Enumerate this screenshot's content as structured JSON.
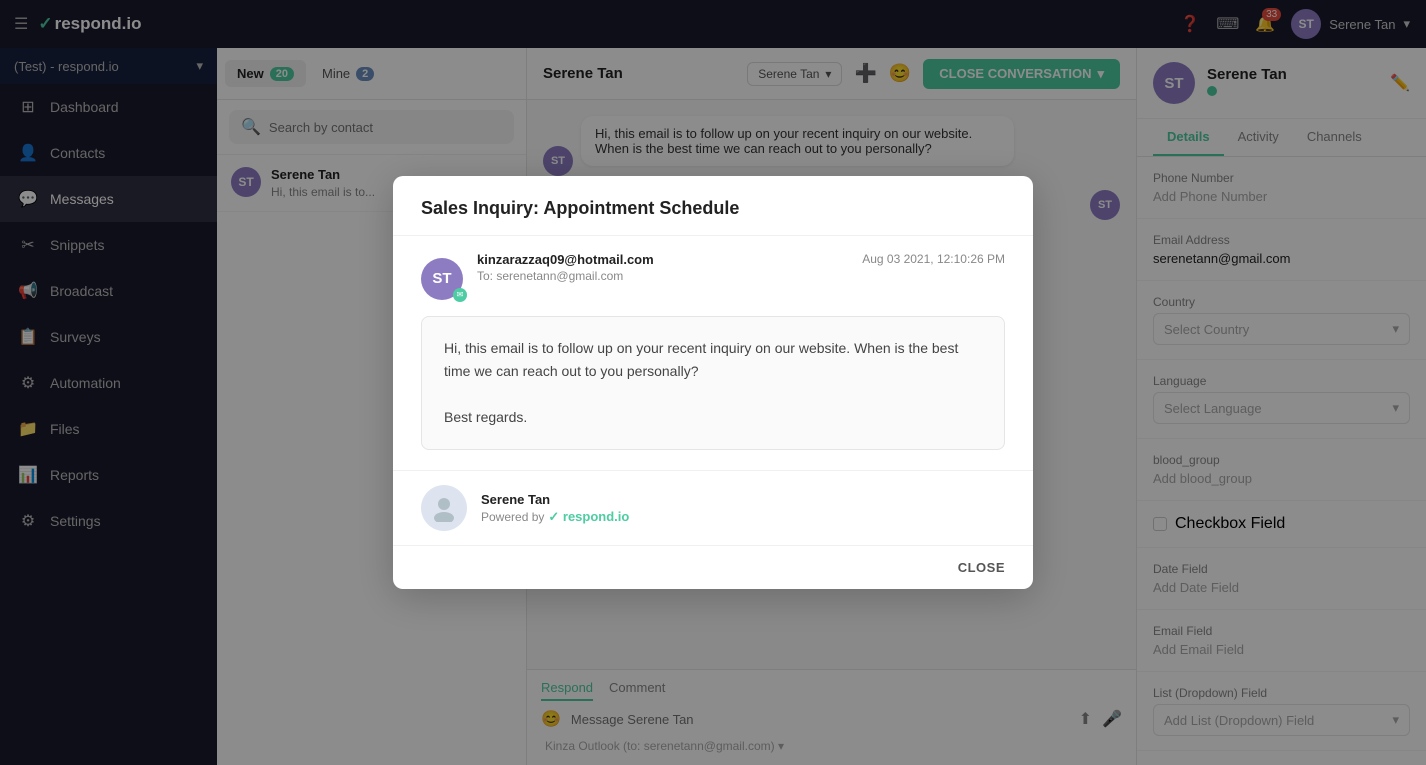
{
  "sidebar": {
    "logo": "respond.io",
    "workspace": "(Test) - respond.io",
    "nav_items": [
      {
        "id": "dashboard",
        "label": "Dashboard",
        "icon": "⊞"
      },
      {
        "id": "contacts",
        "label": "Contacts",
        "icon": "👤"
      },
      {
        "id": "messages",
        "label": "Messages",
        "icon": "💬"
      },
      {
        "id": "snippets",
        "label": "Snippets",
        "icon": "✂️"
      },
      {
        "id": "broadcast",
        "label": "Broadcast",
        "icon": "📢"
      },
      {
        "id": "surveys",
        "label": "Surveys",
        "icon": "📋"
      },
      {
        "id": "automation",
        "label": "Automation",
        "icon": "⚙️"
      },
      {
        "id": "files",
        "label": "Files",
        "icon": "📁"
      },
      {
        "id": "reports",
        "label": "Reports",
        "icon": "📊"
      },
      {
        "id": "settings",
        "label": "Settings",
        "icon": "⚙️"
      }
    ]
  },
  "topbar": {
    "notification_count": "33",
    "user_name": "Serene Tan",
    "user_initials": "ST"
  },
  "conv_list": {
    "tabs": [
      {
        "label": "New",
        "count": "20"
      },
      {
        "label": "Mine",
        "count": "2"
      }
    ],
    "search_placeholder": "Search by contact",
    "items": [
      {
        "name": "Serene Tan",
        "preview": "Hi, this email is to...",
        "initials": "ST"
      }
    ]
  },
  "chat_header": {
    "contact_name": "Serene Tan",
    "assignee": "Serene Tan",
    "close_btn_label": "CLOSE CONVERSATION"
  },
  "chat_footer": {
    "tabs": [
      "Respond",
      "Comment"
    ],
    "active_tab": "Respond",
    "placeholder": "Message Serene Tan"
  },
  "right_panel": {
    "contact_name": "Serene Tan",
    "initials": "ST",
    "tabs": [
      "Details",
      "Activity",
      "Channels"
    ],
    "active_tab": "Details",
    "fields": {
      "phone": {
        "label": "Phone Number",
        "placeholder": "Add Phone Number"
      },
      "email": {
        "label": "Email Address",
        "value": "serenetann@gmail.com"
      },
      "country": {
        "label": "Country",
        "placeholder": "Select Country"
      },
      "language": {
        "label": "Language",
        "placeholder": "Select Language"
      },
      "blood_group": {
        "label": "blood_group",
        "placeholder": "Add blood_group"
      },
      "checkbox_field": {
        "label": "Checkbox Field"
      },
      "date_field": {
        "label": "Date Field",
        "placeholder": "Add Date Field"
      },
      "email_field": {
        "label": "Email Field",
        "placeholder": "Add Email Field"
      },
      "list_dropdown": {
        "label": "List (Dropdown) Field",
        "placeholder": "Add List (Dropdown) Field"
      }
    }
  },
  "modal": {
    "title": "Sales Inquiry: Appointment Schedule",
    "sender_email": "kinzarazzaq09@hotmail.com",
    "recipient": "To: serenetann@gmail.com",
    "timestamp": "Aug 03 2021, 12:10:26 PM",
    "body_line1": "Hi, this email is to follow up on your recent inquiry on our website. When is the best",
    "body_line2": "time we can reach out to you personally?",
    "body_closing": "Best regards.",
    "sig_name": "Serene Tan",
    "sig_powered_by": "Powered by",
    "sig_brand": "✓ respond.io",
    "close_btn": "CLOSE",
    "sender_initials": "ST"
  }
}
